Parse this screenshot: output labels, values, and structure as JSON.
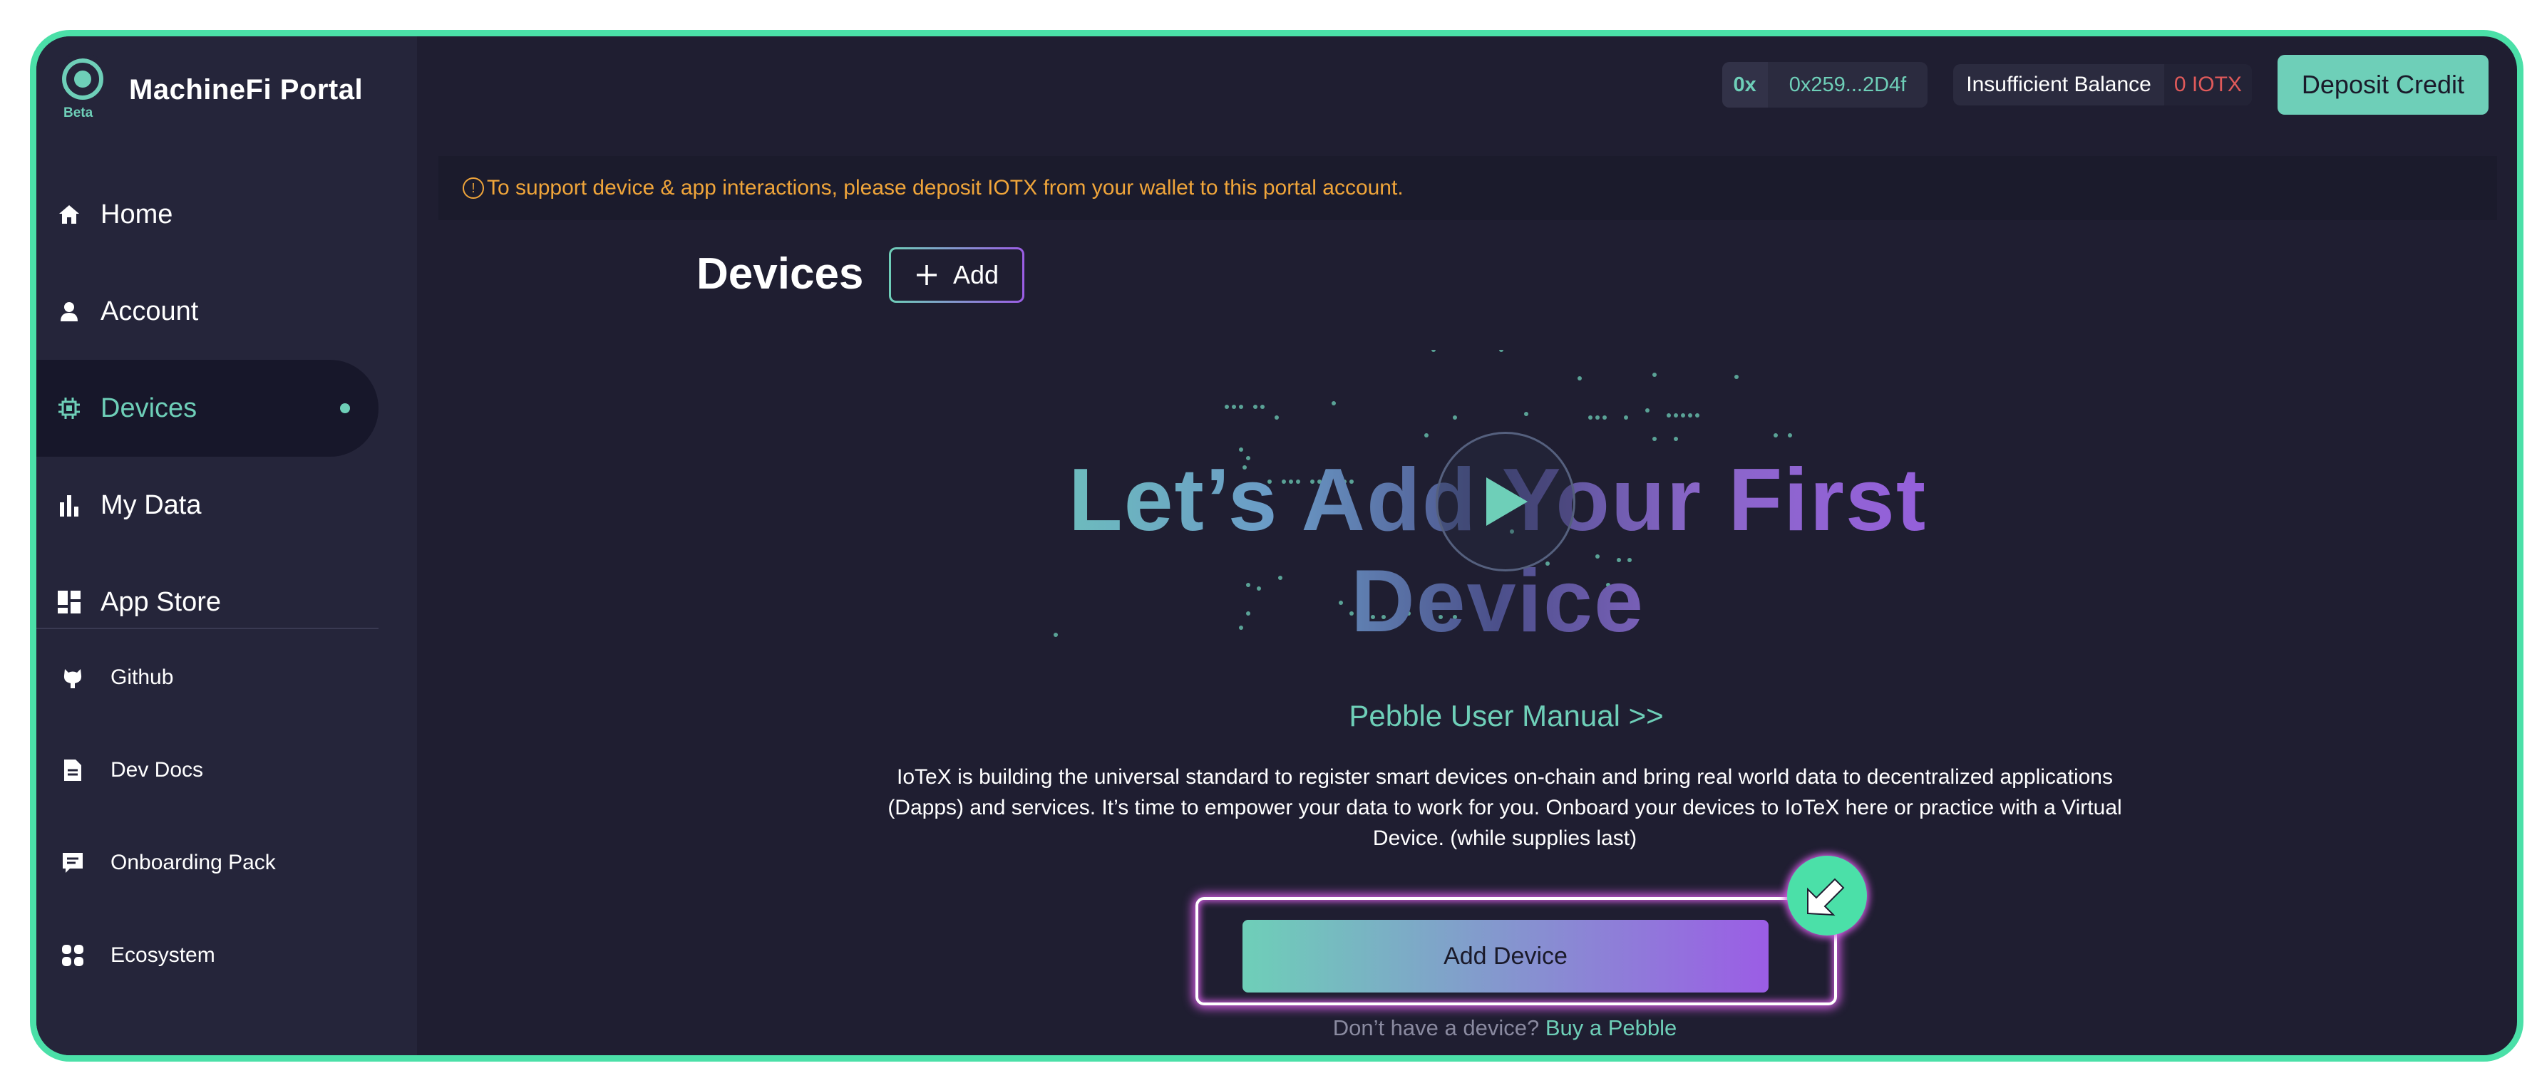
{
  "brand": {
    "name": "MachineFi Portal",
    "badge": "Beta"
  },
  "nav": {
    "items": [
      {
        "label": "Home",
        "icon": "home-icon"
      },
      {
        "label": "Account",
        "icon": "user-icon"
      },
      {
        "label": "Devices",
        "icon": "chip-icon",
        "active": true
      },
      {
        "label": "My Data",
        "icon": "bar-chart-icon"
      },
      {
        "label": "App Store",
        "icon": "grid-icon"
      }
    ],
    "links": [
      {
        "label": "Github",
        "icon": "github-icon"
      },
      {
        "label": "Dev Docs",
        "icon": "document-icon"
      },
      {
        "label": "Onboarding Pack",
        "icon": "message-icon"
      },
      {
        "label": "Ecosystem",
        "icon": "ecosystem-icon"
      }
    ]
  },
  "header": {
    "address_prefix": "0x",
    "address": "0x259...2D4f",
    "balance_label": "Insufficient Balance",
    "balance_amount": "0 IOTX",
    "deposit_button": "Deposit Credit"
  },
  "banner": {
    "text": "To support device & app interactions, please deposit IOTX from your wallet to this portal account."
  },
  "main": {
    "title": "Devices",
    "add_button": "Add",
    "hero_title": "Let’s Add Your First Device",
    "manual_link": "Pebble User Manual >>",
    "description": "IoTeX is building the universal standard to register smart devices on-chain and bring real world data to decentralized applications (Dapps) and services. It’s time to empower your data to work for you. Onboard your devices to IoTeX here or practice with a Virtual Device. (while supplies last)",
    "add_device_button": "Add Device",
    "no_device_text": "Don’t have a device?",
    "buy_link": "Buy a Pebble"
  },
  "colors": {
    "accent": "#6ecfb8",
    "purple": "#9b5de5",
    "warning": "#f0a53a",
    "danger": "#e05a5a",
    "frame": "#4be0a8",
    "background": "#1f1e31"
  }
}
